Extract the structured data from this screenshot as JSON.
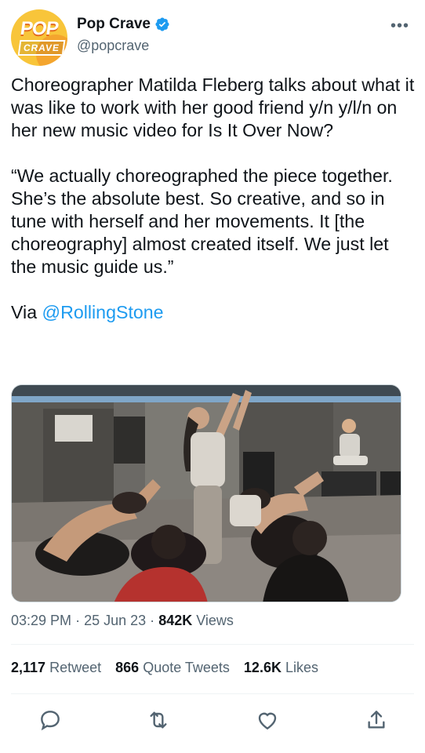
{
  "author": {
    "name": "Pop Crave",
    "handle": "@popcrave",
    "avatar_text_top": "POP",
    "avatar_text_bottom": "CRAVE",
    "verified": true
  },
  "tweet": {
    "paragraph_1": "Choreographer Matilda Fleberg talks about what it was like to work with her good friend y/n y/l/n on her new music video for Is It Over Now?",
    "paragraph_2": "“We actually choreographed the piece together. She’s the absolute best. So creative, and so in tune with herself and her movements. It [the choreography] almost created itself. We just let the music guide us.”",
    "via_prefix": "Via ",
    "via_mention": "@RollingStone"
  },
  "media": {
    "description_icon": "photo"
  },
  "meta": {
    "time": "03:29 PM",
    "separator": "·",
    "date": "25 Jun 23",
    "views_count": "842K",
    "views_label": "Views"
  },
  "stats": {
    "retweets_count": "2,117",
    "retweets_label": "Retweet",
    "quotes_count": "866",
    "quotes_label": "Quote Tweets",
    "likes_count": "12.6K",
    "likes_label": "Likes"
  },
  "actions": {
    "reply": "reply-icon",
    "retweet": "retweet-icon",
    "like": "heart-icon",
    "share": "share-icon"
  },
  "colors": {
    "accent": "#1d9bf0",
    "secondary_text": "#536471",
    "primary_text": "#0f1419",
    "divider": "#eff3f4"
  }
}
